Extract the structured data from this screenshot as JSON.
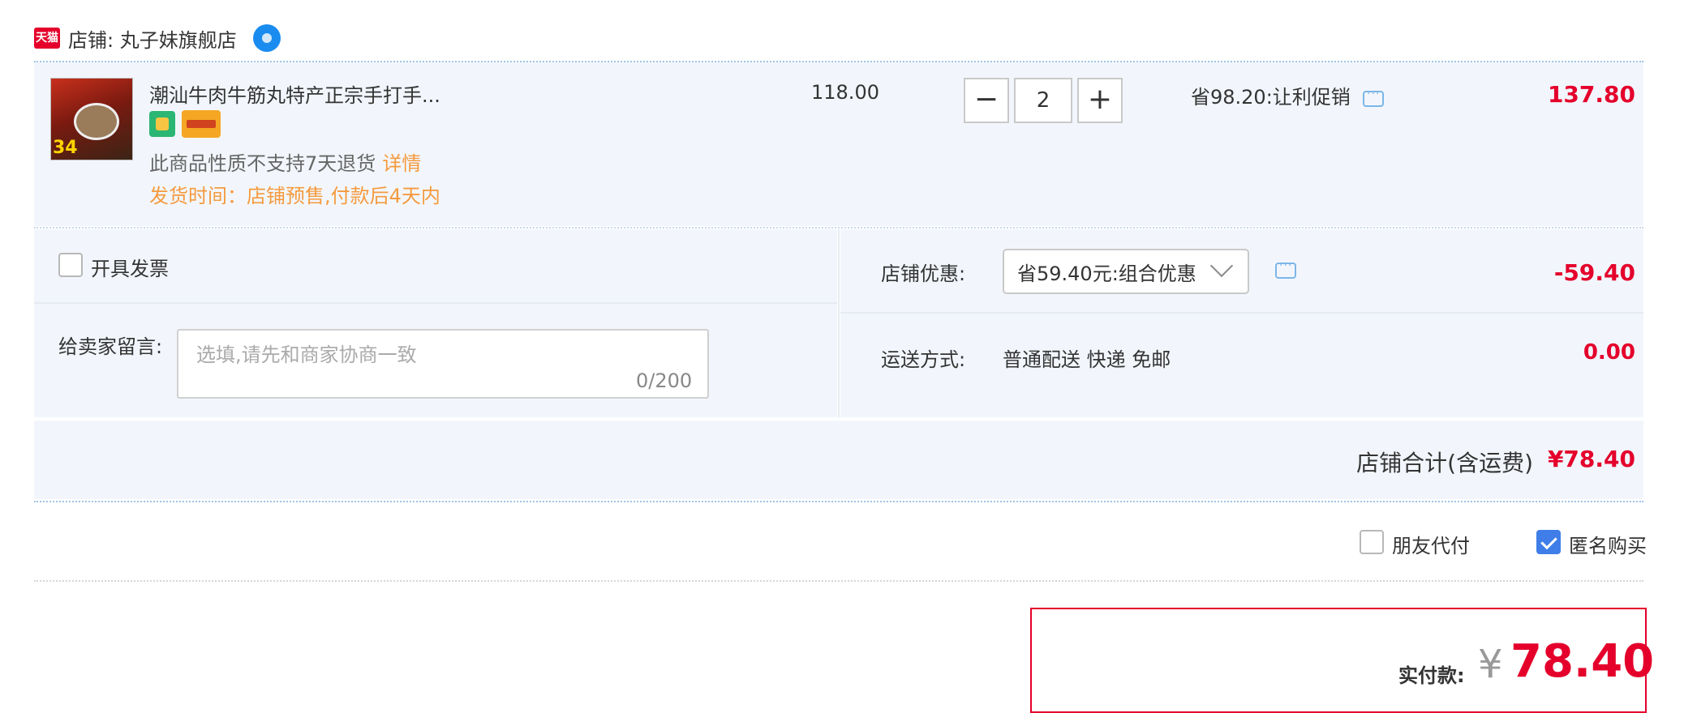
{
  "shop": {
    "logo_text": "天猫",
    "label": "店铺: 丸子妹旗舰店"
  },
  "item": {
    "title": "潮汕牛肉牛筋丸特产正宗手打手...",
    "thumb_number": "34",
    "no_return": "此商品性质不支持7天退货",
    "details_link": "详情",
    "ship_time": "发货时间：店铺预售,付款后4天内",
    "unit_price": "118.00",
    "quantity": "2",
    "promo": "省98.20:让利促销",
    "subtotal": "137.80"
  },
  "invoice": {
    "label": "开具发票",
    "checked": false
  },
  "message": {
    "label": "给卖家留言:",
    "placeholder": "选填,请先和商家协商一致",
    "count": "0/200"
  },
  "store_discount": {
    "label": "店铺优惠:",
    "selected": "省59.40元:组合优惠",
    "amount": "-59.40"
  },
  "shipping": {
    "label": "运送方式:",
    "method": "普通配送 快递 免邮",
    "amount": "0.00"
  },
  "store_total": {
    "label": "店铺合计(含运费)",
    "amount": "¥78.40"
  },
  "options": {
    "friend_pay": "朋友代付",
    "friend_pay_checked": false,
    "anonymous": "匿名购买",
    "anonymous_checked": true
  },
  "payment": {
    "label": "实付款:",
    "currency": "¥",
    "amount": "78.40"
  },
  "colors": {
    "accent_red": "#e4002b",
    "panel_bg": "#f2f6fc",
    "orange": "#f59a3e",
    "checkbox_blue": "#3f7ee8"
  },
  "icons": [
    "tmall-logo-icon",
    "wangwang-icon",
    "chat-icon",
    "minus-icon",
    "plus-icon",
    "chevron-down-icon",
    "checkmark-icon"
  ]
}
